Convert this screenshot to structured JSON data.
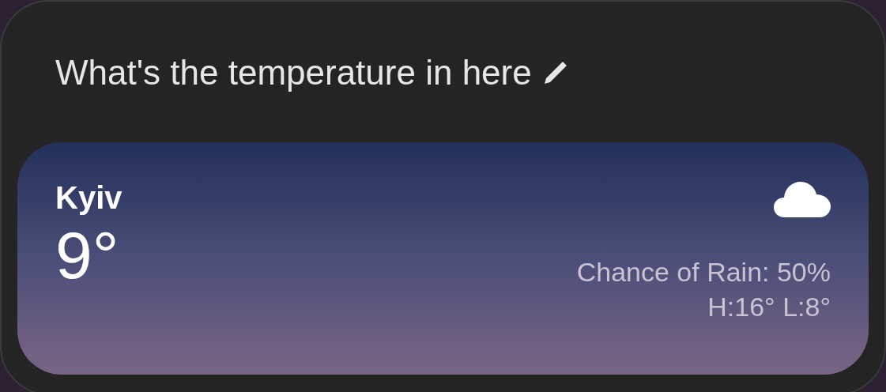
{
  "query": {
    "text": "What's the temperature in here"
  },
  "weather": {
    "city": "Kyiv",
    "temperature": "9°",
    "chance_of_rain": "Chance of Rain: 50%",
    "high_low": "H:16° L:8°"
  }
}
